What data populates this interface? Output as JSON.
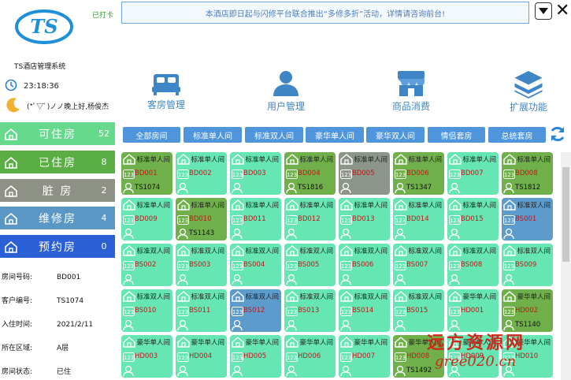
{
  "app": {
    "system_name": "TS酒店管理系统",
    "logo_text": "TS"
  },
  "header": {
    "punch_label": "已打卡",
    "notice": "本酒店即日起与闪修平台联合推出“多修多折”活动，详情请咨询前台!",
    "time": "23:18:36",
    "greeting": "(*ﾟ▽ﾟ)ノノ晚上好,杨俊杰"
  },
  "modules": [
    {
      "label": "客房管理",
      "icon": "bed-icon"
    },
    {
      "label": "用户管理",
      "icon": "user-icon"
    },
    {
      "label": "商品消费",
      "icon": "shop-icon"
    },
    {
      "label": "扩展功能",
      "icon": "layers-icon"
    }
  ],
  "status_buttons": [
    {
      "label": "可住房",
      "count": "52",
      "color": "#66d98c"
    },
    {
      "label": "已住房",
      "count": "8",
      "color": "#5aae43"
    },
    {
      "label": "脏  房",
      "count": "2",
      "color": "#8e9185"
    },
    {
      "label": "维修房",
      "count": "4",
      "color": "#5b97c4"
    },
    {
      "label": "预约房",
      "count": "0",
      "color": "#2b5fd6"
    }
  ],
  "room_info": [
    {
      "key": "房间号码:",
      "value": "BD001"
    },
    {
      "key": "客户编号:",
      "value": "TS1074"
    },
    {
      "key": "入住时间:",
      "value": "2021/2/11"
    },
    {
      "key": "所在区域:",
      "value": "A层"
    },
    {
      "key": "房间状态:",
      "value": "已住"
    }
  ],
  "filters": [
    "全部房间",
    "标准单人间",
    "标准双人间",
    "豪华单人间",
    "豪华双人间",
    "情侣套房",
    "总统套房"
  ],
  "status_colors": {
    "available": "#66e6b2",
    "occupied": "#6fb04a",
    "dirty": "#8c9589",
    "repair": "#5d9bcc"
  },
  "rooms": [
    {
      "type": "标准单人间",
      "number": "BD001",
      "customer": "TS1074",
      "status": "occupied"
    },
    {
      "type": "标准单人间",
      "number": "BD002",
      "customer": "",
      "status": "available"
    },
    {
      "type": "标准单人间",
      "number": "BD003",
      "customer": "",
      "status": "available"
    },
    {
      "type": "标准单人间",
      "number": "BD004",
      "customer": "TS1816",
      "status": "occupied"
    },
    {
      "type": "标准单人间",
      "number": "BD005",
      "customer": "",
      "status": "dirty"
    },
    {
      "type": "标准单人间",
      "number": "BD006",
      "customer": "TS1347",
      "status": "occupied"
    },
    {
      "type": "标准单人间",
      "number": "BD007",
      "customer": "",
      "status": "available"
    },
    {
      "type": "标准单人间",
      "number": "BD008",
      "customer": "TS1812",
      "status": "occupied"
    },
    {
      "type": "标准单人间",
      "number": "BD009",
      "customer": "",
      "status": "available"
    },
    {
      "type": "标准单人间",
      "number": "BD010",
      "customer": "TS1143",
      "status": "occupied"
    },
    {
      "type": "标准单人间",
      "number": "BD011",
      "customer": "",
      "status": "available"
    },
    {
      "type": "标准单人间",
      "number": "BD012",
      "customer": "",
      "status": "available"
    },
    {
      "type": "标准单人间",
      "number": "BD013",
      "customer": "",
      "status": "available"
    },
    {
      "type": "标准单人间",
      "number": "BD014",
      "customer": "",
      "status": "available"
    },
    {
      "type": "标准单人间",
      "number": "BD015",
      "customer": "",
      "status": "available"
    },
    {
      "type": "标准双人间",
      "number": "BS001",
      "customer": "",
      "status": "repair"
    },
    {
      "type": "标准双人间",
      "number": "BS002",
      "customer": "",
      "status": "available"
    },
    {
      "type": "标准双人间",
      "number": "BS003",
      "customer": "",
      "status": "available"
    },
    {
      "type": "标准双人间",
      "number": "BS004",
      "customer": "",
      "status": "available"
    },
    {
      "type": "标准双人间",
      "number": "BS005",
      "customer": "",
      "status": "available"
    },
    {
      "type": "标准双人间",
      "number": "BS006",
      "customer": "",
      "status": "available"
    },
    {
      "type": "标准双人间",
      "number": "BS007",
      "customer": "",
      "status": "available"
    },
    {
      "type": "标准双人间",
      "number": "BS008",
      "customer": "",
      "status": "available"
    },
    {
      "type": "标准双人间",
      "number": "BS009",
      "customer": "",
      "status": "available"
    },
    {
      "type": "标准双人间",
      "number": "BS010",
      "customer": "",
      "status": "available"
    },
    {
      "type": "标准双人间",
      "number": "BS011",
      "customer": "",
      "status": "available"
    },
    {
      "type": "标准双人间",
      "number": "BS012",
      "customer": "",
      "status": "repair"
    },
    {
      "type": "标准双人间",
      "number": "BS013",
      "customer": "",
      "status": "available"
    },
    {
      "type": "标准双人间",
      "number": "BS014",
      "customer": "",
      "status": "available"
    },
    {
      "type": "标准双人间",
      "number": "BS015",
      "customer": "",
      "status": "available"
    },
    {
      "type": "豪华单人间",
      "number": "HD001",
      "customer": "",
      "status": "available"
    },
    {
      "type": "豪华单人间",
      "number": "HD002",
      "customer": "TS1140",
      "status": "occupied"
    },
    {
      "type": "豪华单人间",
      "number": "HD003",
      "customer": "",
      "status": "available"
    },
    {
      "type": "豪华单人间",
      "number": "HD004",
      "customer": "",
      "status": "available"
    },
    {
      "type": "豪华单人间",
      "number": "HD005",
      "customer": "",
      "status": "available"
    },
    {
      "type": "豪华单人间",
      "number": "HD006",
      "customer": "",
      "status": "available"
    },
    {
      "type": "豪华单人间",
      "number": "HD007",
      "customer": "",
      "status": "available"
    },
    {
      "type": "豪华单人间",
      "number": "HD008",
      "customer": "TS1492",
      "status": "occupied"
    },
    {
      "type": "豪华单人间",
      "number": "HD009",
      "customer": "",
      "status": "available"
    },
    {
      "type": "豪华单人间",
      "number": "HD010",
      "customer": "",
      "status": "available"
    }
  ],
  "watermark": {
    "line1": "远方资源网",
    "line2": "gree020.cn"
  }
}
